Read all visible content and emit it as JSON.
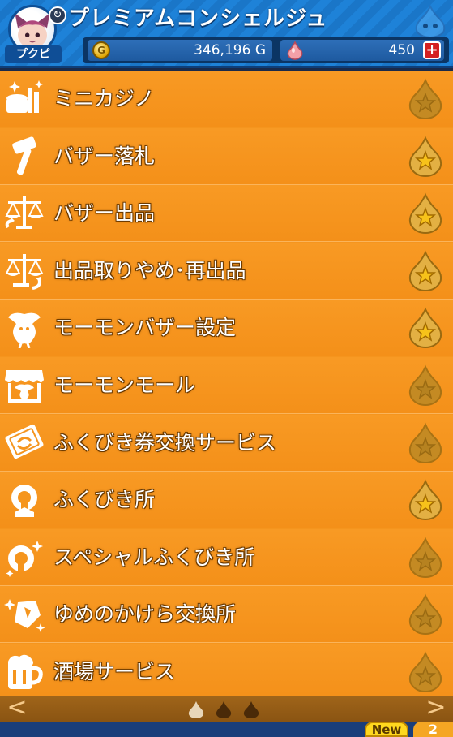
{
  "header": {
    "title": "プレミアムコンシェルジュ",
    "player_name": "プクピ",
    "gold": "346,196 G",
    "gems": "450",
    "plus_label": "+",
    "refresh_icon": "refresh-icon"
  },
  "menu": {
    "items": [
      {
        "label": "ミニカジノ",
        "icon": "casino-icon",
        "favorite": false
      },
      {
        "label": "バザー落札",
        "icon": "hammer-icon",
        "favorite": true
      },
      {
        "label": "バザー出品",
        "icon": "scale-icon",
        "favorite": true
      },
      {
        "label": "出品取りやめ･再出品",
        "icon": "scale-return-icon",
        "favorite": true
      },
      {
        "label": "モーモンバザー設定",
        "icon": "momon-icon",
        "favorite": true
      },
      {
        "label": "モーモンモール",
        "icon": "shop-icon",
        "favorite": false
      },
      {
        "label": "ふくびき券交換サービス",
        "icon": "ticket-exchange-icon",
        "favorite": false
      },
      {
        "label": "ふくびき所",
        "icon": "lottery-icon",
        "favorite": true
      },
      {
        "label": "スペシャルふくびき所",
        "icon": "special-lottery-icon",
        "favorite": false
      },
      {
        "label": "ゆめのかけら交換所",
        "icon": "dream-shard-icon",
        "favorite": false
      },
      {
        "label": "酒場サービス",
        "icon": "tavern-icon",
        "favorite": false
      }
    ]
  },
  "pager": {
    "prev": "<",
    "next": ">",
    "current_page": 1,
    "total_pages": 3
  },
  "bottom": {
    "new_label": "New",
    "count": "2"
  },
  "colors": {
    "header_blue": "#1e82d8",
    "row_orange": "#f5951e",
    "star_active": "#f5c518",
    "star_inactive": "#c88a1a"
  }
}
